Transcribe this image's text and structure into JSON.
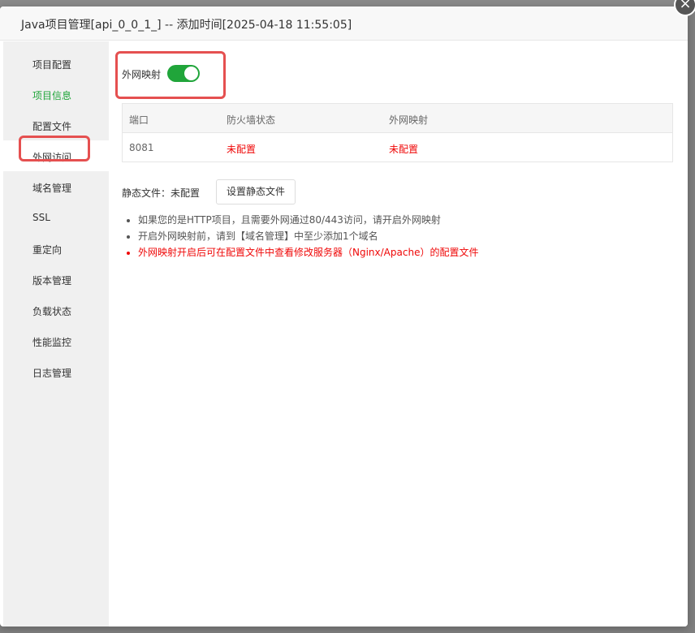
{
  "dialog": {
    "title": "Java项目管理[api_0_0_1_] -- 添加时间[2025-04-18 11:55:05]",
    "close_symbol": "×"
  },
  "sidebar": {
    "items": [
      {
        "label": "项目配置"
      },
      {
        "label": "项目信息"
      },
      {
        "label": "配置文件"
      },
      {
        "label": "外网访问"
      },
      {
        "label": "域名管理"
      },
      {
        "label": "SSL"
      },
      {
        "label": "重定向"
      },
      {
        "label": "版本管理"
      },
      {
        "label": "负载状态"
      },
      {
        "label": "性能监控"
      },
      {
        "label": "日志管理"
      }
    ]
  },
  "mapping": {
    "toggle_label": "外网映射",
    "enabled": true
  },
  "table": {
    "headers": [
      "端口",
      "防火墙状态",
      "外网映射"
    ],
    "rows": [
      [
        "8081",
        "未配置",
        "未配置"
      ]
    ]
  },
  "static_files": {
    "label": "静态文件：未配置",
    "button_label": "设置静态文件"
  },
  "tips": [
    "如果您的是HTTP项目，且需要外网通过80/443访问，请开启外网映射",
    "开启外网映射前，请到【域名管理】中至少添加1个域名",
    "外网映射开启后可在配置文件中查看修改服务器（Nginx/Apache）的配置文件"
  ],
  "colors": {
    "accent_green": "#20a53a",
    "warning_red": "#ef0808",
    "highlight_red": "#e55050"
  }
}
